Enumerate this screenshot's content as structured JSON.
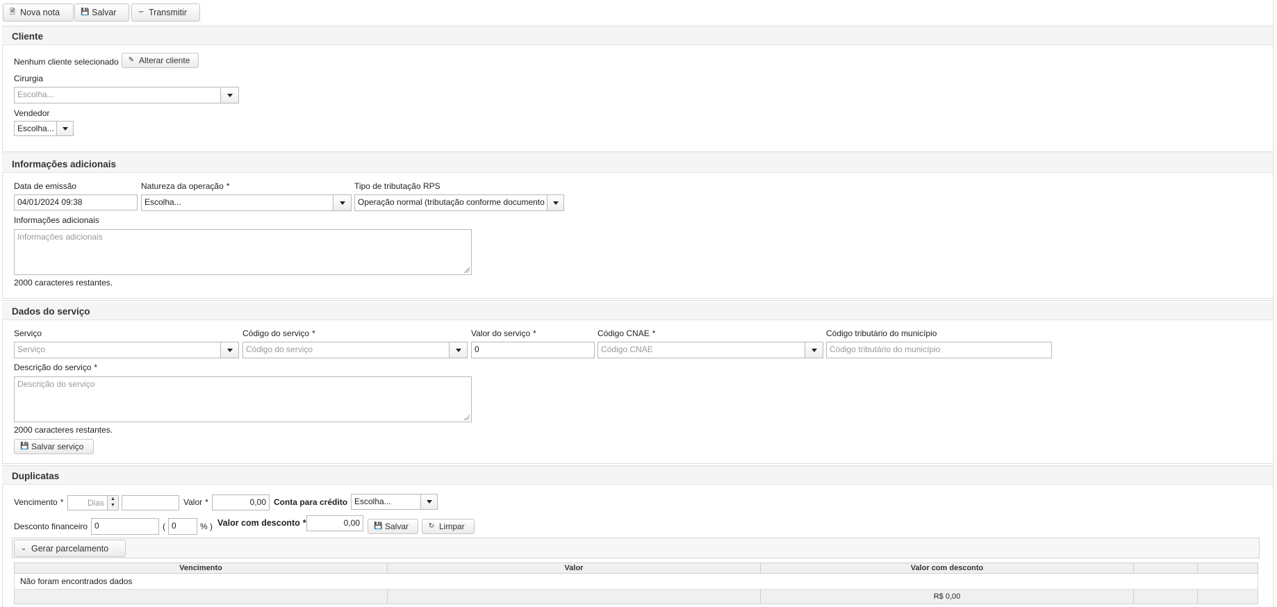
{
  "toolbar": {
    "nova_nota": "Nova nota",
    "salvar": "Salvar",
    "transmitir": "Transmitir"
  },
  "cliente": {
    "title": "Cliente",
    "status": "Nenhum cliente selecionado",
    "alterar": "Alterar cliente",
    "cirurgia_label": "Cirurgia",
    "cirurgia_placeholder": "Escolha...",
    "vendedor_label": "Vendedor",
    "vendedor_value": "Escolha..."
  },
  "info": {
    "title": "Informações adicionais",
    "data_label": "Data de emissão",
    "data_value": "04/01/2024 09:38",
    "natureza_label": "Natureza da operação",
    "natureza_value": "Escolha...",
    "tributacao_label": "Tipo de tributação RPS",
    "tributacao_value": "Operação normal (tributação conforme documento e",
    "adicionais_label": "Informações adicionais",
    "adicionais_placeholder": "Informações adicionais",
    "restantes": "2000 caracteres restantes."
  },
  "servico": {
    "title": "Dados do serviço",
    "servico_label": "Serviço",
    "servico_placeholder": "Serviço",
    "codigo_label": "Código do serviço",
    "codigo_placeholder": "Código do serviço",
    "valor_label": "Valor do serviço",
    "valor_value": "0",
    "cnae_label": "Código CNAE",
    "cnae_placeholder": "Código CNAE",
    "trib_mun_label": "Código tributário do município",
    "trib_mun_placeholder": "Código tributário do município",
    "descricao_label": "Descrição do serviço",
    "descricao_placeholder": "Descrição do serviço",
    "restantes": "2000 caracteres restantes.",
    "salvar": "Salvar serviço"
  },
  "duplicatas": {
    "title": "Duplicatas",
    "vencimento_label": "Vencimento",
    "dias_placeholder": "Dias",
    "valor_label": "Valor",
    "valor_value": "0,00",
    "conta_label": "Conta para crédito",
    "conta_value": "Escolha...",
    "desconto_label": "Desconto financeiro",
    "desconto_value": "0",
    "paren_open": "(",
    "pct_value": "0",
    "pct_close": "% )",
    "valor_desc_label": "Valor com desconto",
    "valor_desc_value": "0,00",
    "salvar": "Salvar",
    "limpar": "Limpar",
    "gerar": "Gerar parcelamento",
    "required_mark": "*",
    "table": {
      "headers": [
        "Vencimento",
        "Valor",
        "Valor com desconto",
        "",
        ""
      ],
      "empty": "Não foram encontrados dados",
      "footer_total": "R$ 0,00"
    }
  }
}
